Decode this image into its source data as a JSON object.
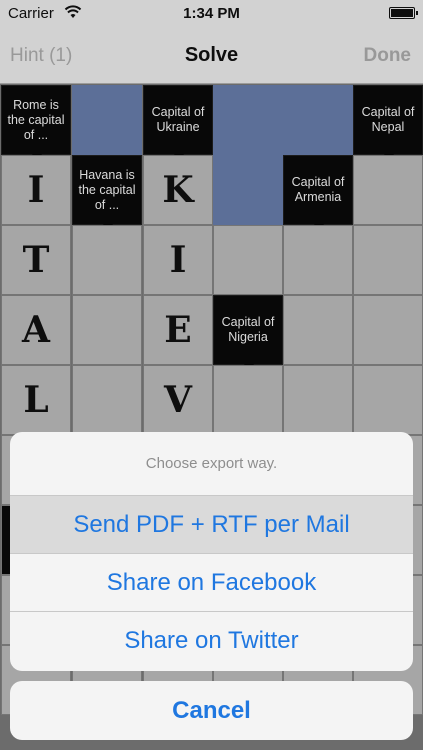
{
  "status": {
    "carrier": "Carrier",
    "time": "1:34 PM"
  },
  "nav": {
    "hint_label": "Hint (1)",
    "title": "Solve",
    "done_label": "Done"
  },
  "grid": {
    "clues": {
      "rome": "Rome is the capital of ...",
      "ukraine": "Capital of Ukraine",
      "nepal": "Capital of Nepal",
      "havana": "Havana is the capital of ...",
      "armenia": "Capital of Armenia",
      "nigeria": "Capital of Nigeria"
    },
    "letters": {
      "c0r1": "I",
      "c0r2": "T",
      "c0r3": "A",
      "c0r4": "L",
      "c2r1": "K",
      "c2r2": "I",
      "c2r3": "E",
      "c2r4": "V"
    }
  },
  "sheet": {
    "caption": "Choose export way.",
    "mail_label": "Send PDF + RTF per Mail",
    "facebook_label": "Share on Facebook",
    "twitter_label": "Share on Twitter",
    "cancel_label": "Cancel"
  },
  "colors": {
    "accent": "#1f77e0",
    "blue_cell": "#6d83b3",
    "clue_bg": "#0a0a0a"
  }
}
